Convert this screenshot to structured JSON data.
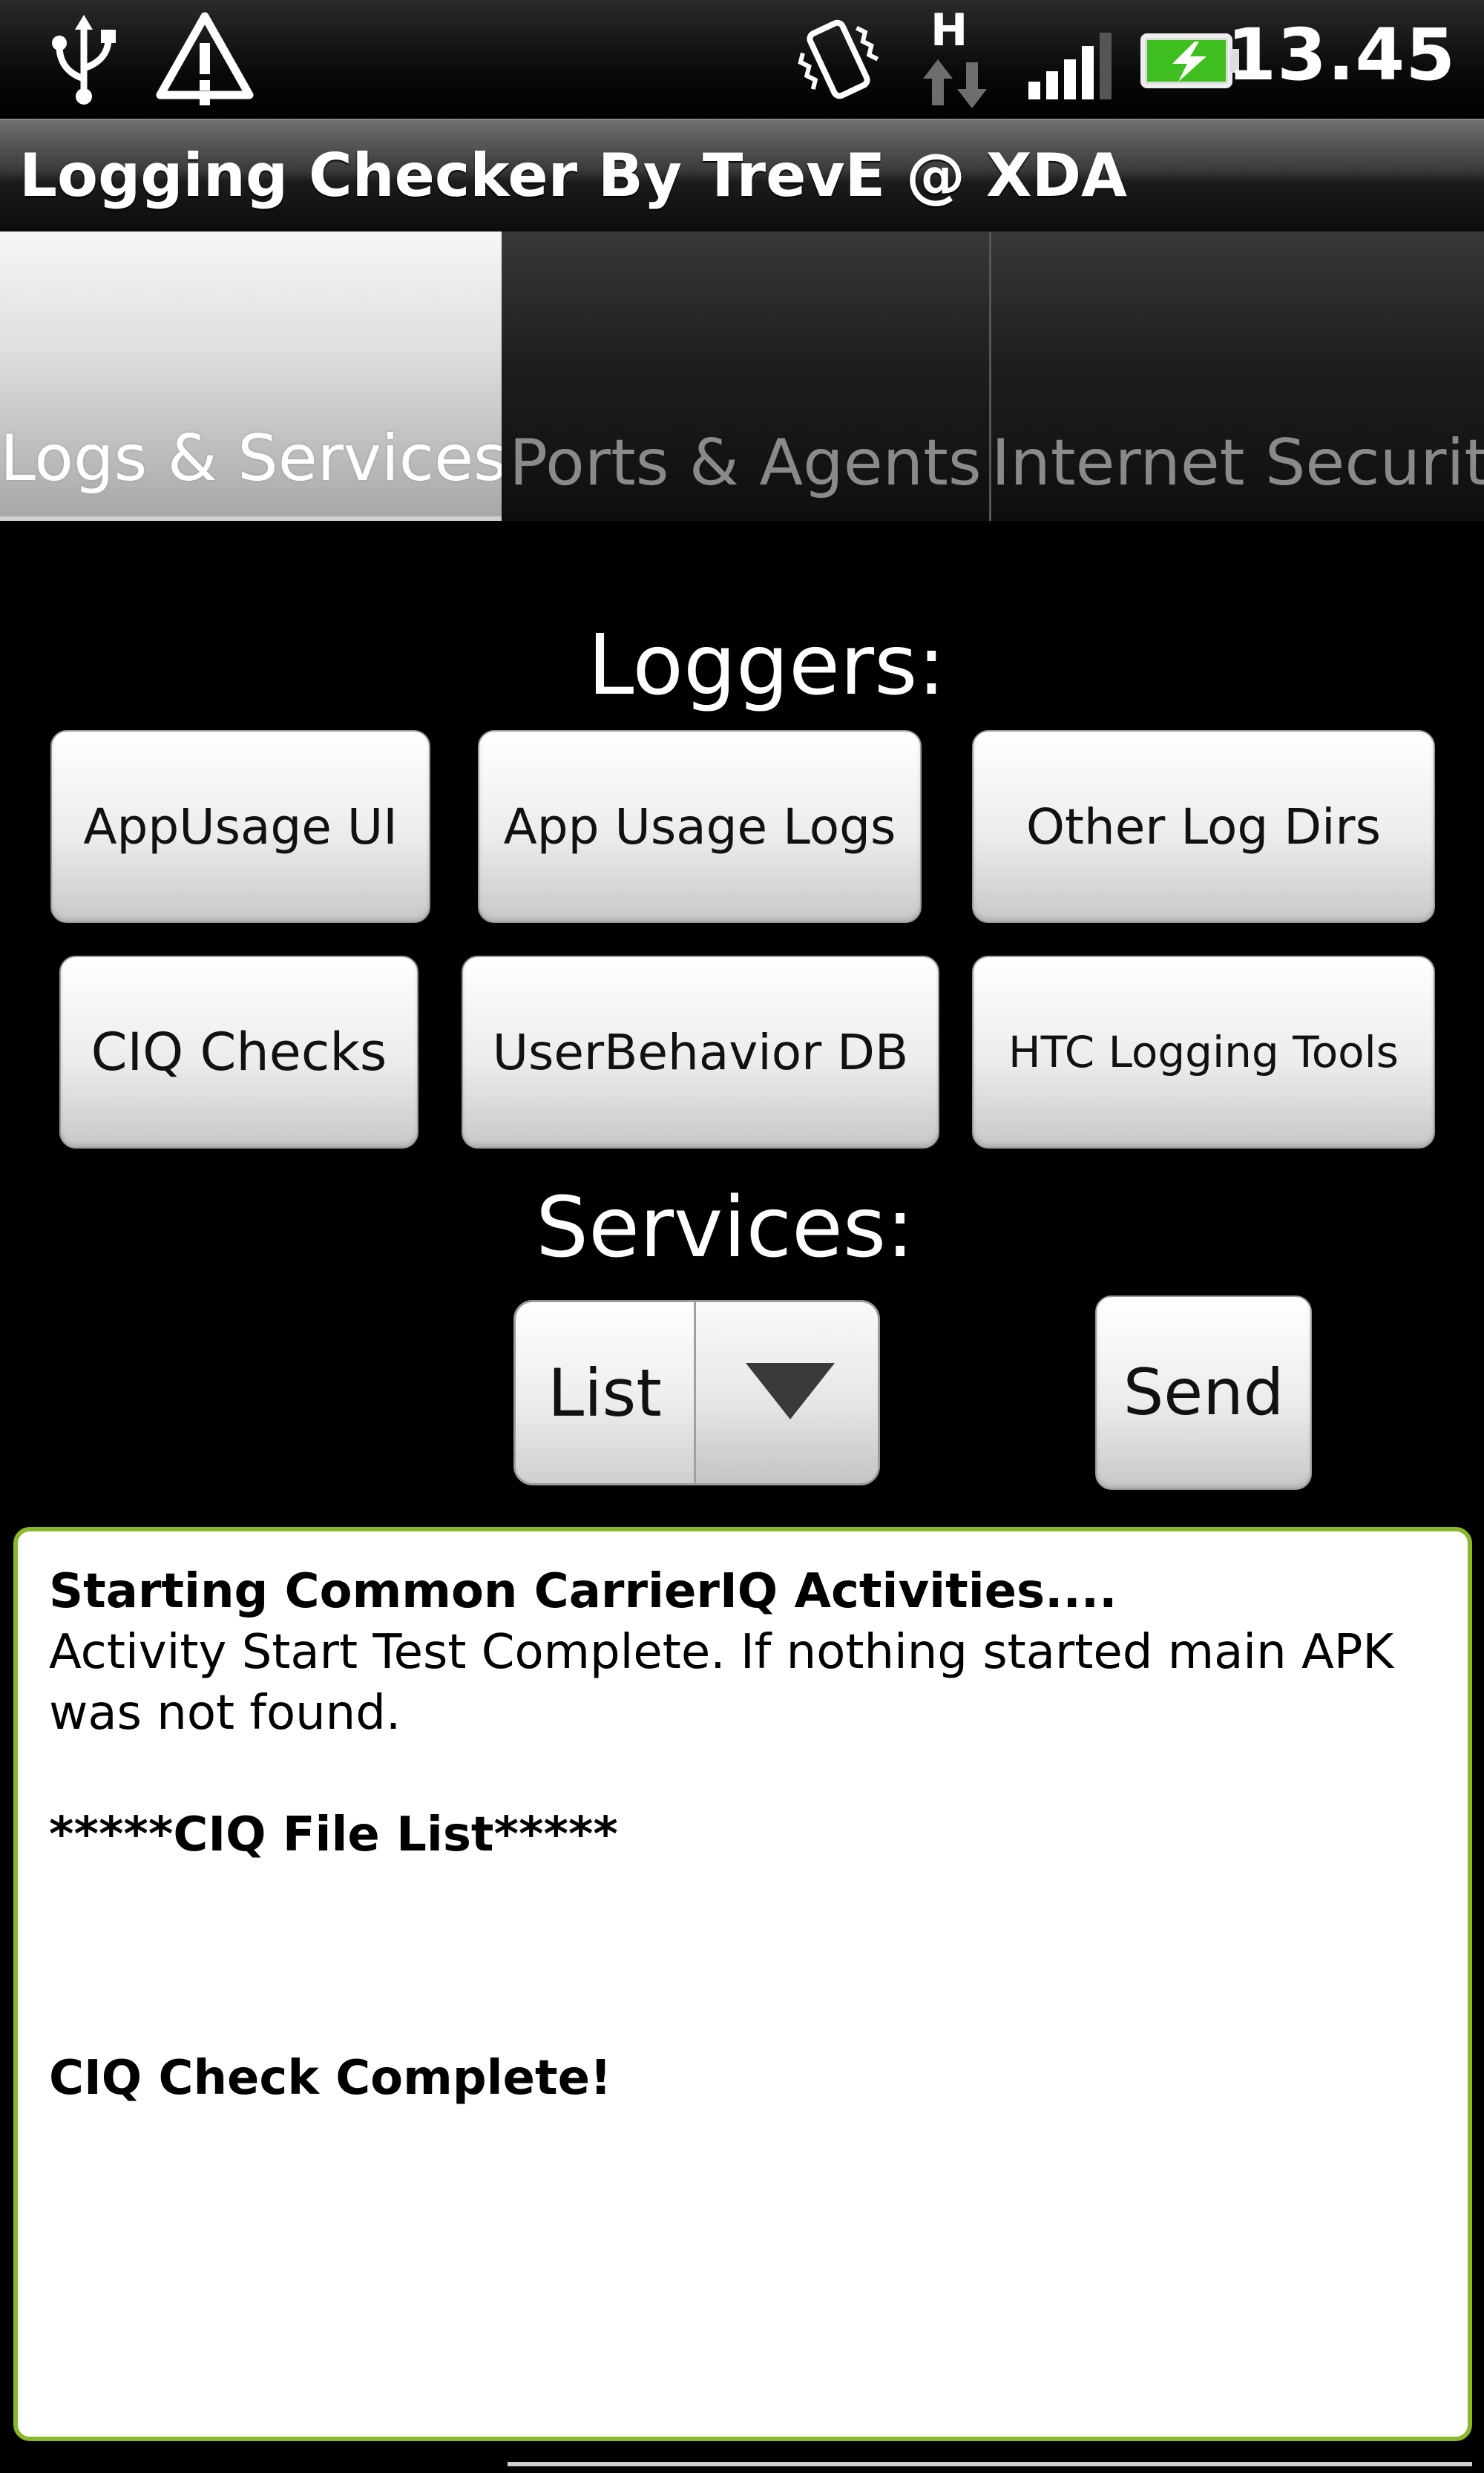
{
  "status_bar": {
    "time": "13.45",
    "network_type": "H",
    "icons": [
      "usb-icon",
      "warning-icon",
      "vibrate-icon",
      "data-arrows-icon",
      "signal-icon",
      "battery-charging-icon"
    ],
    "battery_color": "#3fbf1f"
  },
  "app": {
    "title": "Logging Checker By TrevE @ XDA"
  },
  "tabs": [
    {
      "label": "Logs & Services",
      "active": true
    },
    {
      "label": "Ports & Agents",
      "active": false
    },
    {
      "label": "Internet Security",
      "active": false
    }
  ],
  "loggers": {
    "heading": "Loggers:",
    "buttons": [
      "AppUsage UI",
      "App Usage Logs",
      "Other Log Dirs",
      "CIQ Checks",
      "UserBehavior DB",
      "HTC Logging Tools"
    ]
  },
  "services": {
    "heading": "Services:",
    "spinner_value": "List",
    "send_label": "Send"
  },
  "output": {
    "line1": "Starting Common CarrierIQ Activities....",
    "line2": "Activity Start Test Complete. If nothing started main APK",
    "line3": "was not found.",
    "line4": "*****CIQ File List*****",
    "line5": "CIQ Check Complete!",
    "border_color": "#8ab82b"
  }
}
